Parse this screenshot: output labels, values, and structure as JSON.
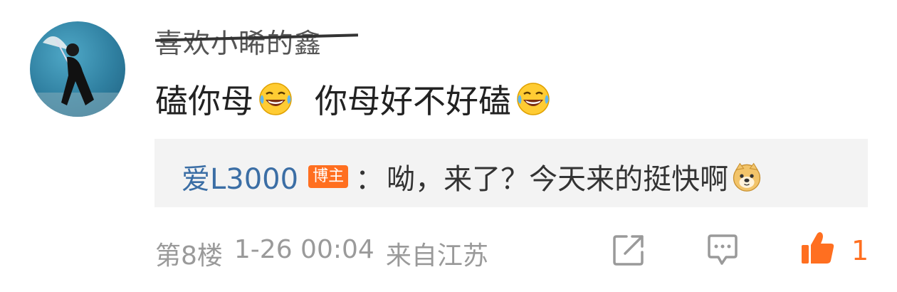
{
  "comment": {
    "username": "喜欢小睎的鑫",
    "text_part1": "磕你母",
    "text_part2": "你母好不好磕",
    "emoji_name": "laughing-tears-icon"
  },
  "reply": {
    "author": "爱L3000",
    "badge": "博主",
    "separator": "：",
    "text": "呦，来了？今天来的挺快啊",
    "emoji_name": "doge-icon"
  },
  "footer": {
    "floor": "第8楼",
    "datetime": "1-26 00:04",
    "location": "来自江苏"
  },
  "actions": {
    "like_count": "1",
    "accent_color": "#ff6f20"
  }
}
